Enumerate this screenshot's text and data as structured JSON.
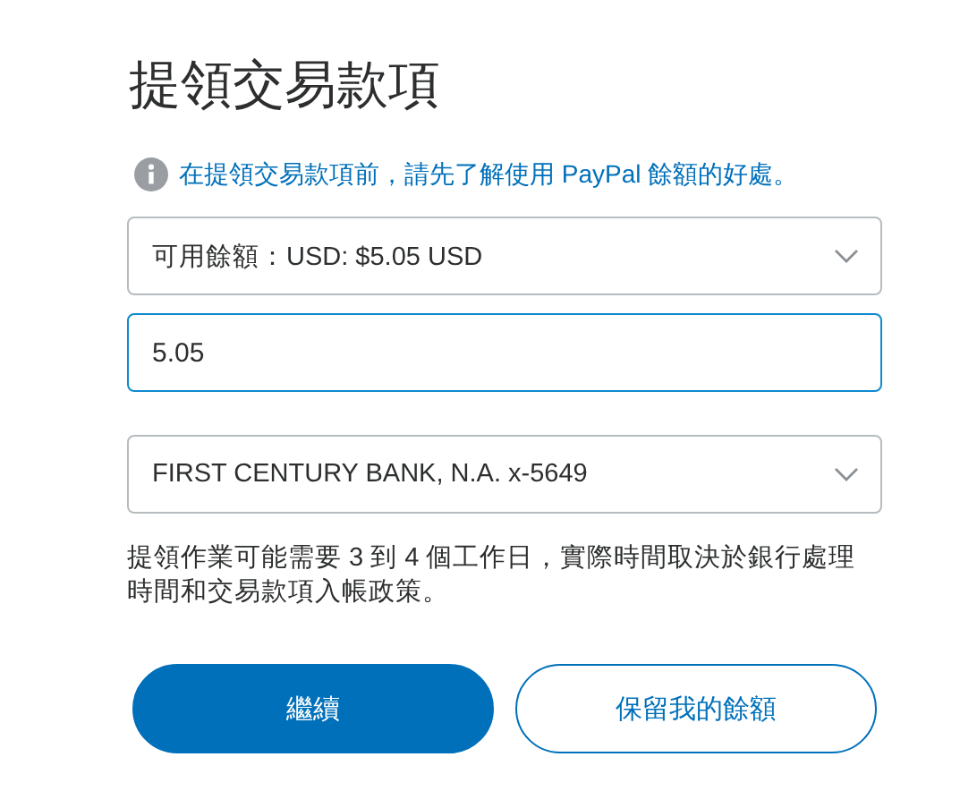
{
  "title": "提領交易款項",
  "info_link": "在提領交易款項前，請先了解使用 PayPal 餘額的好處。",
  "balance_select": {
    "value": "可用餘額：USD: $5.05 USD"
  },
  "amount_field": {
    "value": "5.05",
    "focused": true
  },
  "bank_select": {
    "value": "FIRST CENTURY BANK, N.A. x-5649"
  },
  "note": "提領作業可能需要 3 到 4 個工作日，實際時間取決於銀行處理時間和交易款項入帳政策。",
  "buttons": [
    {
      "label": "繼續",
      "kind": "primary"
    },
    {
      "label": "保留我的餘額",
      "kind": "secondary"
    }
  ]
}
